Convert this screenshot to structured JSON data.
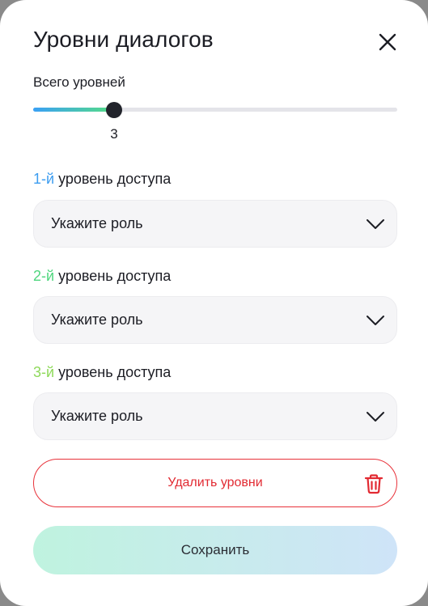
{
  "dialog": {
    "title": "Уровни диалогов",
    "close_icon": "close-icon"
  },
  "levels_slider": {
    "label": "Всего уровней",
    "value": "3",
    "fraction": 0.222,
    "fill_gradient": [
      "#3aa0f5",
      "#55dd85"
    ]
  },
  "access_levels": [
    {
      "ordinal": "1-й",
      "ordinal_color": "#3d9df0",
      "suffix": "уровень доступа",
      "placeholder": "Укажите роль"
    },
    {
      "ordinal": "2-й",
      "ordinal_color": "#4fd67e",
      "suffix": "уровень доступа",
      "placeholder": "Укажите роль"
    },
    {
      "ordinal": "3-й",
      "ordinal_color": "#8ed95a",
      "suffix": "уровень доступа",
      "placeholder": "Укажите роль"
    }
  ],
  "buttons": {
    "delete_label": "Удалить уровни",
    "delete_icon": "trash-icon",
    "save_label": "Сохранить"
  },
  "colors": {
    "danger": "#e8323a",
    "text": "#1c1d24",
    "field_bg": "#f5f5f7"
  }
}
